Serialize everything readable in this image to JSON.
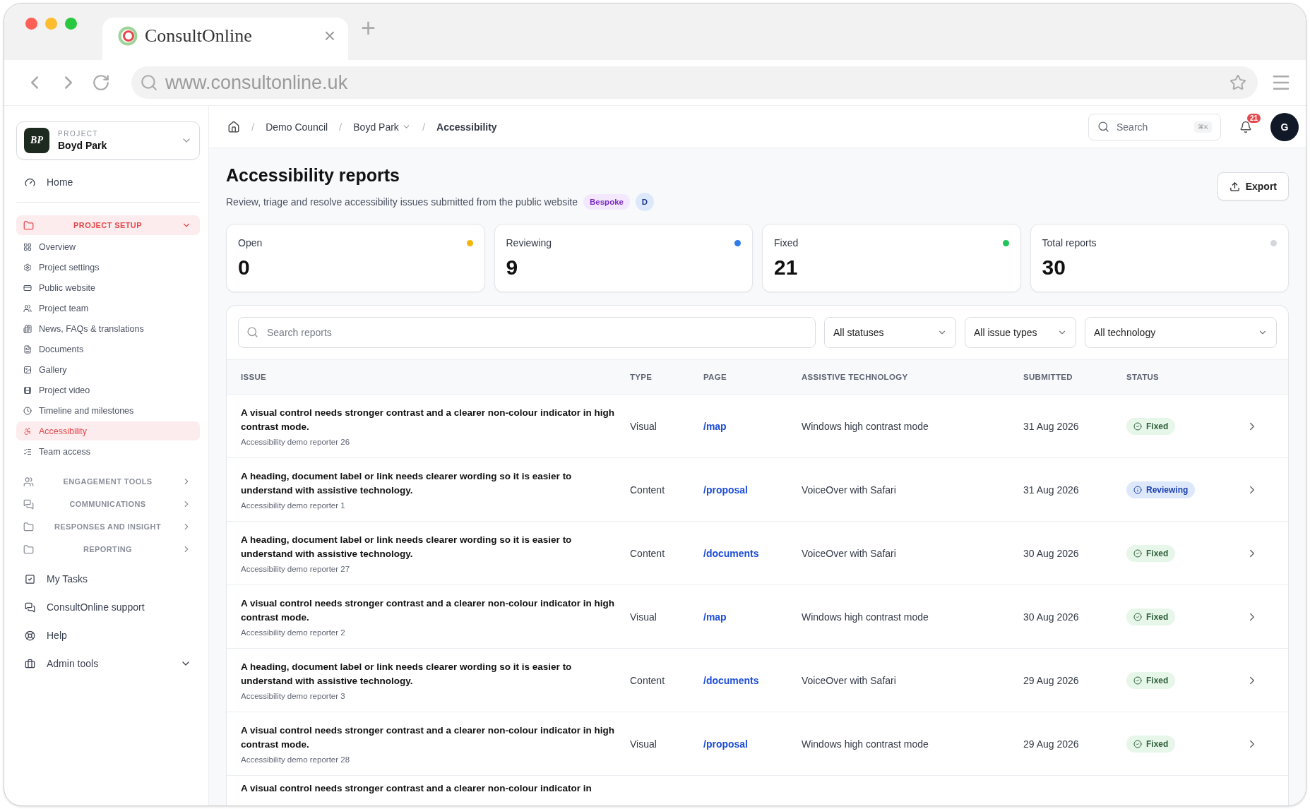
{
  "browser": {
    "tab_title": "ConsultOnline",
    "close": "×",
    "new_tab": "+",
    "url": "www.consultonline.uk"
  },
  "sidebar": {
    "project_label": "PROJECT",
    "project_name": "Boyd Park",
    "project_initials": "BP",
    "home": "Home",
    "sections": [
      {
        "label": "PROJECT SETUP",
        "selected": true,
        "expanded": true,
        "children": [
          {
            "label": "Overview",
            "selected": false
          },
          {
            "label": "Project settings",
            "selected": false
          },
          {
            "label": "Public website",
            "selected": false
          },
          {
            "label": "Project team",
            "selected": false
          },
          {
            "label": "News, FAQs & translations",
            "selected": false
          },
          {
            "label": "Documents",
            "selected": false
          },
          {
            "label": "Gallery",
            "selected": false
          },
          {
            "label": "Project video",
            "selected": false
          },
          {
            "label": "Timeline and milestones",
            "selected": false
          },
          {
            "label": "Accessibility",
            "selected": true
          },
          {
            "label": "Team access",
            "selected": false
          }
        ]
      },
      {
        "label": "ENGAGEMENT TOOLS",
        "selected": false,
        "expanded": false
      },
      {
        "label": "COMMUNICATIONS",
        "selected": false,
        "expanded": false
      },
      {
        "label": "RESPONSES AND INSIGHT",
        "selected": false,
        "expanded": false
      },
      {
        "label": "REPORTING",
        "selected": false,
        "expanded": false
      }
    ],
    "footer_items": [
      {
        "label": "My Tasks",
        "expandable": false
      },
      {
        "label": "ConsultOnline support",
        "expandable": false
      },
      {
        "label": "Help",
        "expandable": false
      },
      {
        "label": "Admin tools",
        "expandable": true
      }
    ]
  },
  "header": {
    "breadcrumb": [
      {
        "label": "Demo Council",
        "kind": "link"
      },
      {
        "label": "Boyd Park",
        "kind": "dropdown"
      },
      {
        "label": "Accessibility",
        "kind": "current"
      }
    ],
    "separator": "/",
    "search": "Search",
    "shortcut": "⌘K",
    "notifications": "21",
    "avatar": "G"
  },
  "page": {
    "title": "Accessibility reports",
    "subtitle": "Review, triage and resolve accessibility issues submitted from the public website",
    "tags": [
      {
        "label": "Bespoke",
        "kind": "plan"
      },
      {
        "label": "D",
        "kind": "initial"
      }
    ],
    "export": "Export"
  },
  "stats": [
    {
      "label": "Open",
      "value": "0",
      "color": "#f5b50a"
    },
    {
      "label": "Reviewing",
      "value": "9",
      "color": "#2f7be8"
    },
    {
      "label": "Fixed",
      "value": "21",
      "color": "#1fc45a"
    },
    {
      "label": "Total reports",
      "value": "30",
      "color": "#d4d6dc"
    }
  ],
  "filters": {
    "placeholder": "Search reports",
    "selects": [
      "All statuses",
      "All issue types",
      "All technology"
    ]
  },
  "table": {
    "columns": [
      "ISSUE",
      "TYPE",
      "PAGE",
      "ASSISTIVE TECHNOLOGY",
      "SUBMITTED",
      "STATUS"
    ],
    "rows": [
      {
        "issue": "A visual control needs stronger contrast and a clearer non-colour indicator in high contrast mode.",
        "reporter": "Accessibility demo reporter 26",
        "type": "Visual",
        "page": "/map",
        "technology": "Windows high contrast mode",
        "submitted": "31 Aug 2026",
        "status": {
          "label": "Fixed",
          "kind": "fixed"
        }
      },
      {
        "issue": "A heading, document label or link needs clearer wording so it is easier to understand with assistive technology.",
        "reporter": "Accessibility demo reporter 1",
        "type": "Content",
        "page": "/proposal",
        "technology": "VoiceOver with Safari",
        "submitted": "31 Aug 2026",
        "status": {
          "label": "Reviewing",
          "kind": "reviewing"
        }
      },
      {
        "issue": "A heading, document label or link needs clearer wording so it is easier to understand with assistive technology.",
        "reporter": "Accessibility demo reporter 27",
        "type": "Content",
        "page": "/documents",
        "technology": "VoiceOver with Safari",
        "submitted": "30 Aug 2026",
        "status": {
          "label": "Fixed",
          "kind": "fixed"
        }
      },
      {
        "issue": "A visual control needs stronger contrast and a clearer non-colour indicator in high contrast mode.",
        "reporter": "Accessibility demo reporter 2",
        "type": "Visual",
        "page": "/map",
        "technology": "Windows high contrast mode",
        "submitted": "30 Aug 2026",
        "status": {
          "label": "Fixed",
          "kind": "fixed"
        }
      },
      {
        "issue": "A heading, document label or link needs clearer wording so it is easier to understand with assistive technology.",
        "reporter": "Accessibility demo reporter 3",
        "type": "Content",
        "page": "/documents",
        "technology": "VoiceOver with Safari",
        "submitted": "29 Aug 2026",
        "status": {
          "label": "Fixed",
          "kind": "fixed"
        }
      },
      {
        "issue": "A visual control needs stronger contrast and a clearer non-colour indicator in high contrast mode.",
        "reporter": "Accessibility demo reporter 28",
        "type": "Visual",
        "page": "/proposal",
        "technology": "Windows high contrast mode",
        "submitted": "29 Aug 2026",
        "status": {
          "label": "Fixed",
          "kind": "fixed"
        }
      },
      {
        "issue": "A visual control needs stronger contrast and a clearer non-colour indicator in"
      }
    ]
  }
}
